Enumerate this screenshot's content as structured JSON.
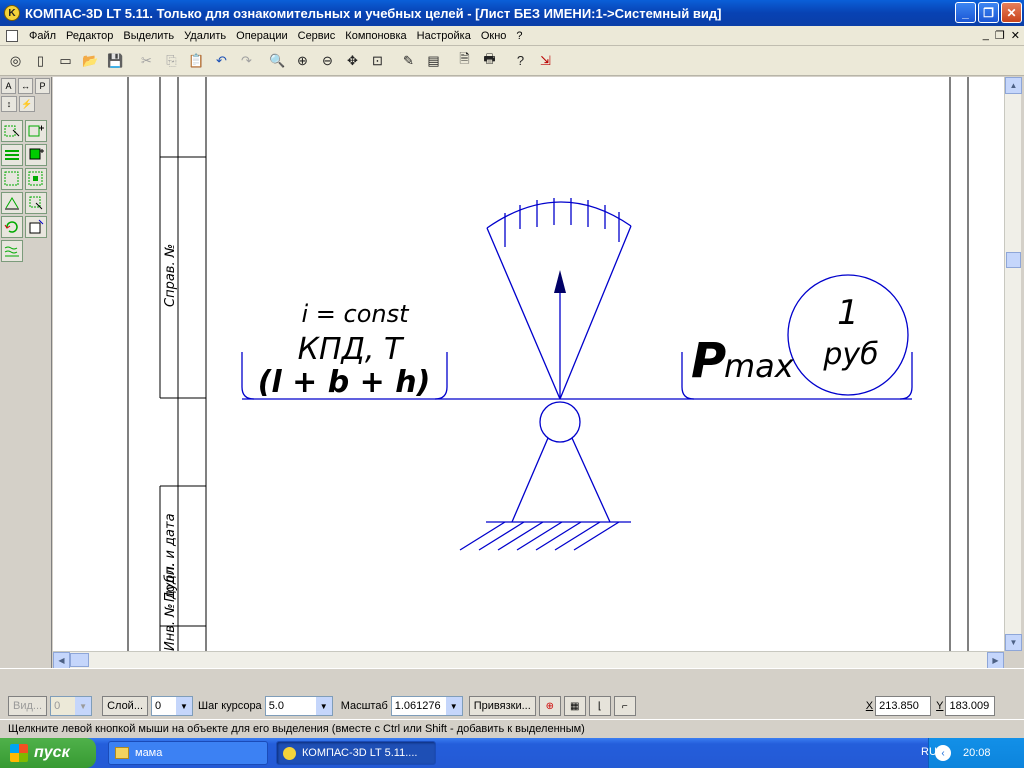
{
  "window": {
    "title": "КОМПАС-3D LT 5.11. Только для ознакомительных и учебных целей - [Лист БЕЗ ИМЕНИ:1->Системный вид]",
    "icon": "kompas-logo-icon",
    "controls": {
      "minimize": "_",
      "restore": "❐",
      "close": "✕"
    }
  },
  "menubar": {
    "items": [
      "Файл",
      "Редактор",
      "Выделить",
      "Удалить",
      "Операции",
      "Сервис",
      "Компоновка",
      "Настройка",
      "Окно",
      "?"
    ],
    "mdi_controls": {
      "minimize": "_",
      "restore": "❐",
      "close": "✕"
    }
  },
  "toolbar": {
    "buttons": [
      {
        "icon": "new-model-icon",
        "glyph": "◎"
      },
      {
        "icon": "new-sheet-icon",
        "glyph": "▯"
      },
      {
        "icon": "new-fragment-icon",
        "glyph": "▭"
      },
      {
        "icon": "open-folder-icon",
        "glyph": "📂"
      },
      {
        "icon": "save-icon",
        "glyph": "💾"
      },
      {
        "icon": "cut-icon",
        "glyph": "✂"
      },
      {
        "icon": "copy-icon",
        "glyph": "⎘"
      },
      {
        "icon": "paste-icon",
        "glyph": "📋"
      },
      {
        "icon": "undo-icon",
        "glyph": "↶"
      },
      {
        "icon": "redo-icon",
        "glyph": "↷"
      },
      {
        "icon": "zoom-icon",
        "glyph": "🔍"
      },
      {
        "icon": "zoom-in-icon",
        "glyph": "⊕"
      },
      {
        "icon": "zoom-out-icon",
        "glyph": "⊖"
      },
      {
        "icon": "pan-icon",
        "glyph": "✥"
      },
      {
        "icon": "zoom-fit-icon",
        "glyph": "⊡"
      },
      {
        "icon": "refresh-icon",
        "glyph": "✎"
      },
      {
        "icon": "layers-icon",
        "glyph": "▤"
      },
      {
        "icon": "print-preview-icon",
        "glyph": "🗎"
      },
      {
        "icon": "print-icon",
        "glyph": "🖶"
      },
      {
        "icon": "help-pointer-icon",
        "glyph": "?"
      },
      {
        "icon": "exit-icon",
        "glyph": "⇲"
      }
    ]
  },
  "drawing": {
    "stamp_labels": [
      "Справ. №",
      "Подп. и дата",
      "Инв. № дубл."
    ],
    "formula_line1": "i = const",
    "formula_line2": "КПД, T",
    "formula_line3": "(l + b + h)",
    "pmax_main": "P",
    "pmax_sub": "max",
    "circle_number": "1",
    "circle_unit": "руб"
  },
  "params": {
    "view_label": "Вид...",
    "view_value": "0",
    "layer_label": "Слой...",
    "layer_value": "0",
    "step_label": "Шаг курсора",
    "step_value": "5.0",
    "scale_label": "Масштаб",
    "scale_value": "1.061276",
    "snaps_label": "Привязки...",
    "x_label": "X",
    "x_value": "213.850",
    "y_label": "Y",
    "y_value": "183.009"
  },
  "hint": "Щелкните левой кнопкой мыши на объекте для его выделения (вместе с Ctrl или Shift - добавить к выделенным)",
  "taskbar": {
    "start_label": "пуск",
    "tasks": [
      {
        "label": "мама",
        "icon": "folder-icon",
        "active": false
      },
      {
        "label": "КОМПАС-3D LT 5.11....",
        "icon": "kompas-logo-icon",
        "active": true
      }
    ],
    "language": "RU",
    "clock": "20:08"
  },
  "colors": {
    "drawing_line": "#0000cc",
    "titlebar": "#0842b3",
    "taskbar": "#245edb"
  }
}
